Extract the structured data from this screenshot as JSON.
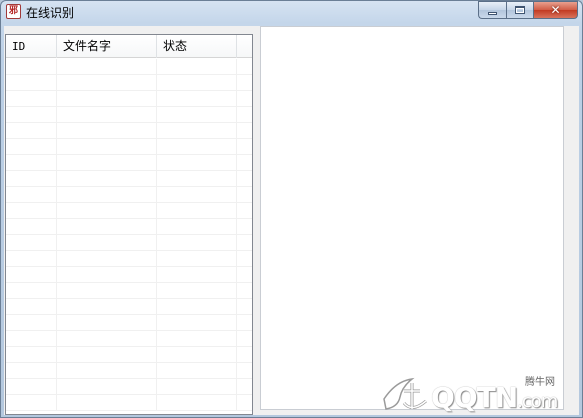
{
  "window": {
    "title": "在线识别",
    "app_icon_glyph": "邪",
    "icon_names": {
      "app": "app-icon",
      "minimize": "minimize-icon",
      "maximize": "maximize-icon",
      "close": "close-icon"
    }
  },
  "file_list": {
    "columns": [
      "ID",
      "文件名字",
      "状态"
    ],
    "rows": []
  },
  "result_panel": {
    "text": ""
  },
  "watermark": {
    "brand": "QQTN",
    "suffix": ".com",
    "sub": "腾牛网"
  },
  "colors": {
    "title_bar": "#c4d6ea",
    "close_button": "#c23a22",
    "client_bg": "#f0f0f0"
  }
}
